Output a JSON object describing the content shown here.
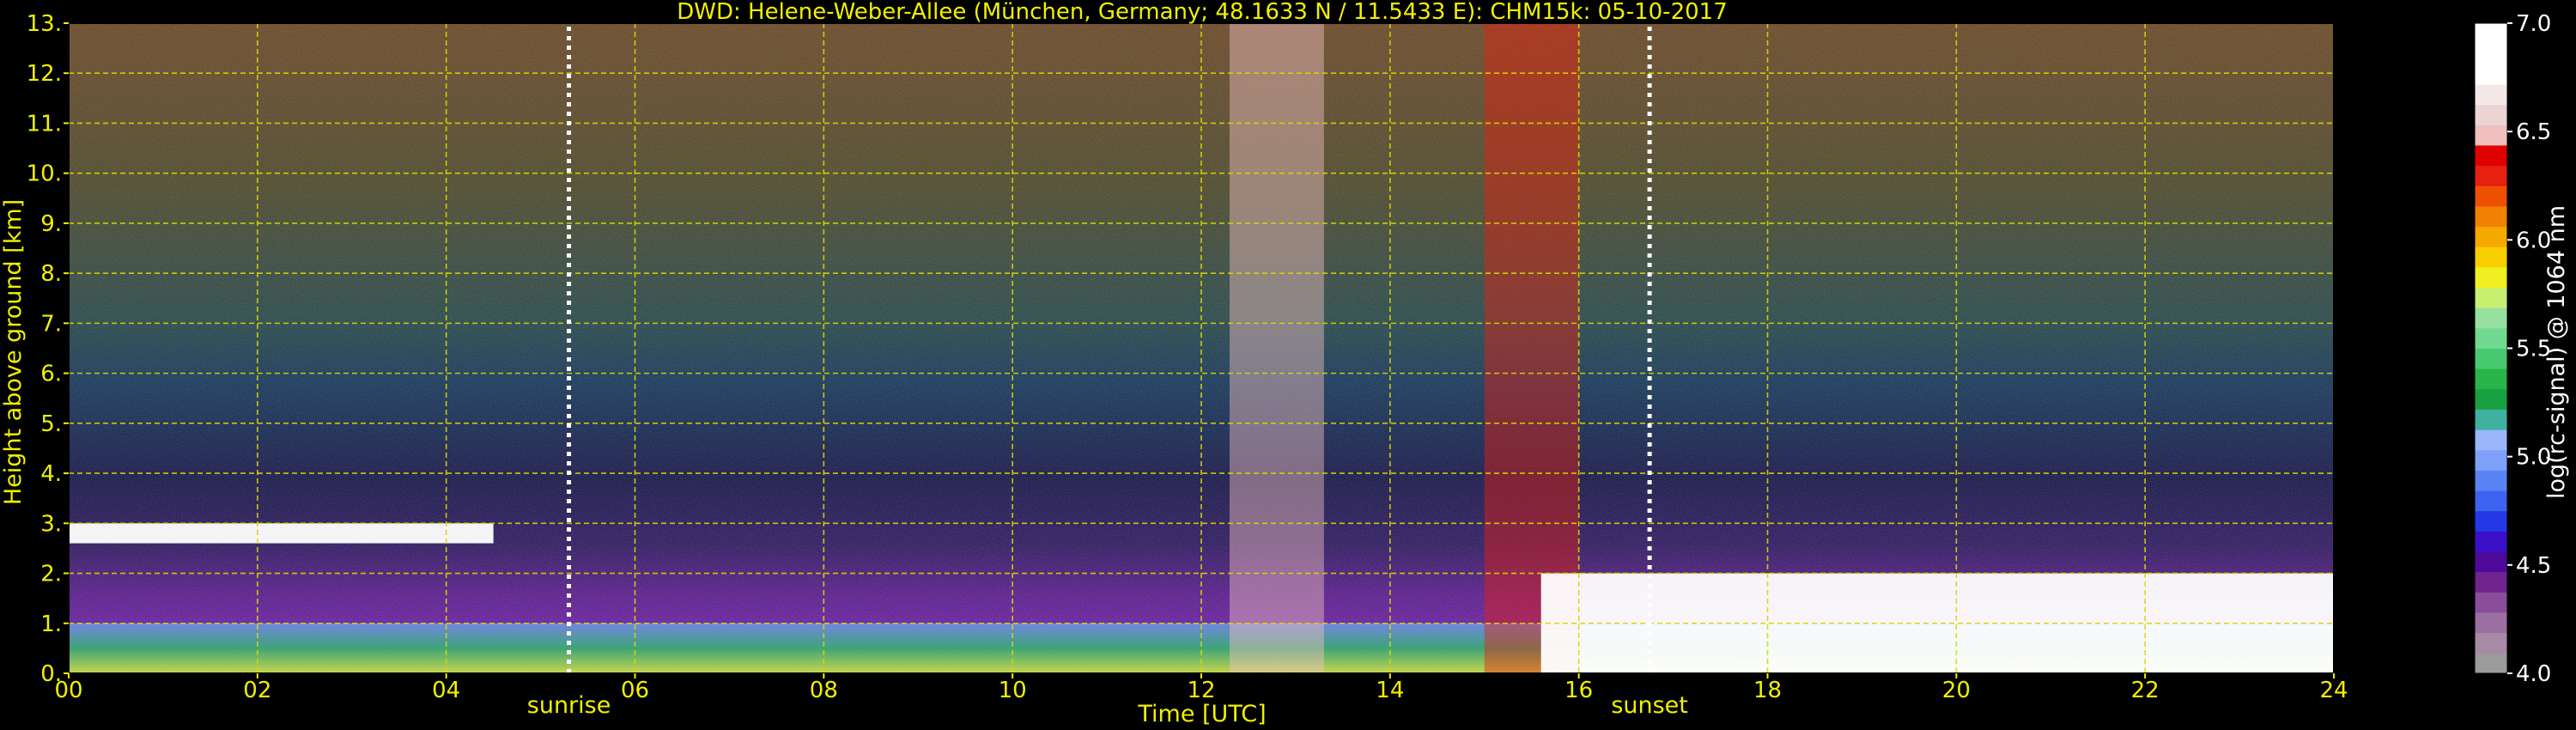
{
  "chart_data": {
    "type": "heatmap",
    "title": "DWD: Helene-Weber-Allee (München, Germany; 48.1633 N / 11.5433 E):    CHM15k: 05-10-2017",
    "xlabel": "Time [UTC]",
    "ylabel": "Height above ground [km]",
    "xlim": [
      0,
      24
    ],
    "ylim": [
      0,
      13
    ],
    "x_ticks": [
      "00",
      "02",
      "04",
      "06",
      "08",
      "10",
      "12",
      "14",
      "16",
      "18",
      "20",
      "22",
      "24"
    ],
    "y_ticks": [
      "0.",
      "1.",
      "2.",
      "3.",
      "4.",
      "5.",
      "6.",
      "7.",
      "8.",
      "9.",
      "10.",
      "11.",
      "12.",
      "13."
    ],
    "grid": true,
    "annotations": [
      {
        "text": "sunrise",
        "x": 5.3
      },
      {
        "text": "sunset",
        "x": 16.75
      }
    ],
    "colorbar": {
      "label": "log(rc-signal) @ 1064 nm",
      "range": [
        4.0,
        7.0
      ],
      "ticks": [
        "4.0",
        "4.5",
        "5.0",
        "5.5",
        "6.0",
        "6.5",
        "7.0"
      ],
      "colors": [
        "#9b9b9b",
        "#a68aa6",
        "#9c6fa3",
        "#8a4d9a",
        "#70248f",
        "#4d0a9a",
        "#3a10c8",
        "#2438e6",
        "#3c64f0",
        "#5a84f5",
        "#7ea0f8",
        "#9cb6fa",
        "#40b0a0",
        "#18a040",
        "#28b448",
        "#48c870",
        "#70d890",
        "#98e0a0",
        "#c8f070",
        "#f0f020",
        "#f8d000",
        "#f4a800",
        "#f08000",
        "#ec5000",
        "#e82010",
        "#e00000",
        "#f0c0c0",
        "#ecd4d4",
        "#f4e8e8",
        "#ffffff",
        "#ffffff",
        "#ffffff"
      ]
    },
    "features": [
      {
        "name": "aerosol boundary layer",
        "x": [
          0,
          24
        ],
        "y": [
          0,
          1.0
        ],
        "level": 5.0
      },
      {
        "name": "cloud layer",
        "x": [
          0,
          4.5
        ],
        "y": [
          2.6,
          3.0
        ],
        "level": 7.0
      },
      {
        "name": "high cloud",
        "x": [
          12.3,
          13.3
        ],
        "y": [
          0,
          13
        ],
        "level": 6.5
      },
      {
        "name": "high cloud",
        "x": [
          15.0,
          16.0
        ],
        "y": [
          0,
          13
        ],
        "level": 6.3
      },
      {
        "name": "low cloud",
        "x": [
          15.6,
          24
        ],
        "y": [
          0,
          2.0
        ],
        "level": 7.0
      }
    ]
  }
}
